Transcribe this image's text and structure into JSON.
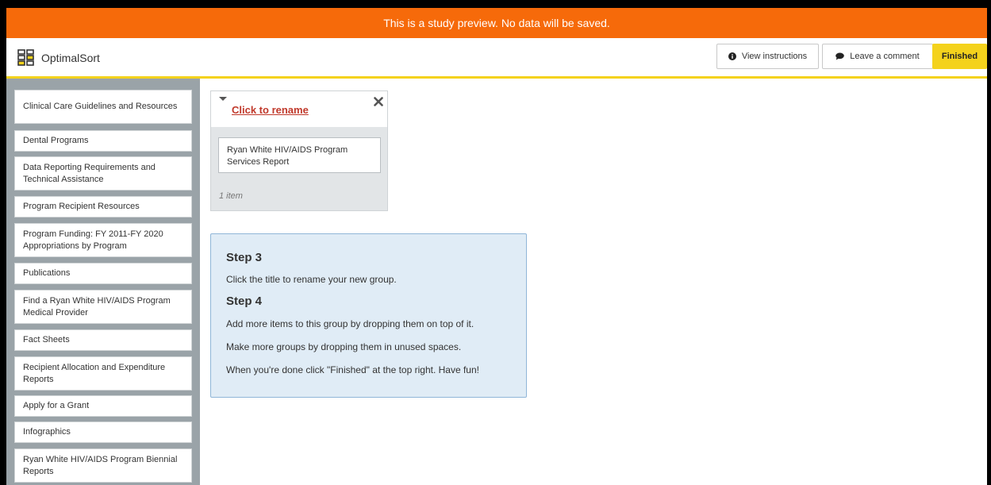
{
  "banner": {
    "text": "This is a study preview. No data will be saved."
  },
  "header": {
    "app_name": "OptimalSort",
    "view_instructions_label": "View instructions",
    "leave_comment_label": "Leave a comment",
    "finished_label": "Finished"
  },
  "sidebar": {
    "cards": [
      "Clinical Care Guidelines and Resources",
      "Dental Programs",
      "Data Reporting Requirements and Technical Assistance",
      "Program Recipient Resources",
      "Program Funding: FY 2011-FY 2020 Appropriations by Program",
      "Publications",
      "Find a Ryan White HIV/AIDS Program Medical Provider",
      "Fact Sheets",
      "Recipient Allocation and Expenditure Reports",
      "Apply for a Grant",
      "Infographics",
      "Ryan White HIV/AIDS Program Biennial Reports"
    ]
  },
  "group": {
    "title": "Click to rename",
    "items": [
      "Ryan White HIV/AIDS Program Services Report"
    ],
    "count": "1 item"
  },
  "tip": {
    "step3_title": "Step 3",
    "step3_text": "Click the title to rename your new group.",
    "step4_title": "Step 4",
    "step4_lines": [
      "Add more items to this group by dropping them on top of it.",
      "Make more groups by dropping them in unused spaces.",
      "When you're done click \"Finished\" at the top right. Have fun!"
    ]
  },
  "colors": {
    "banner": "#f66a0a",
    "accent_yellow": "#f4d21c",
    "sidebar_bg": "#9aa3a8",
    "group_title": "#c0392b",
    "tip_bg": "#e0ecf6"
  }
}
